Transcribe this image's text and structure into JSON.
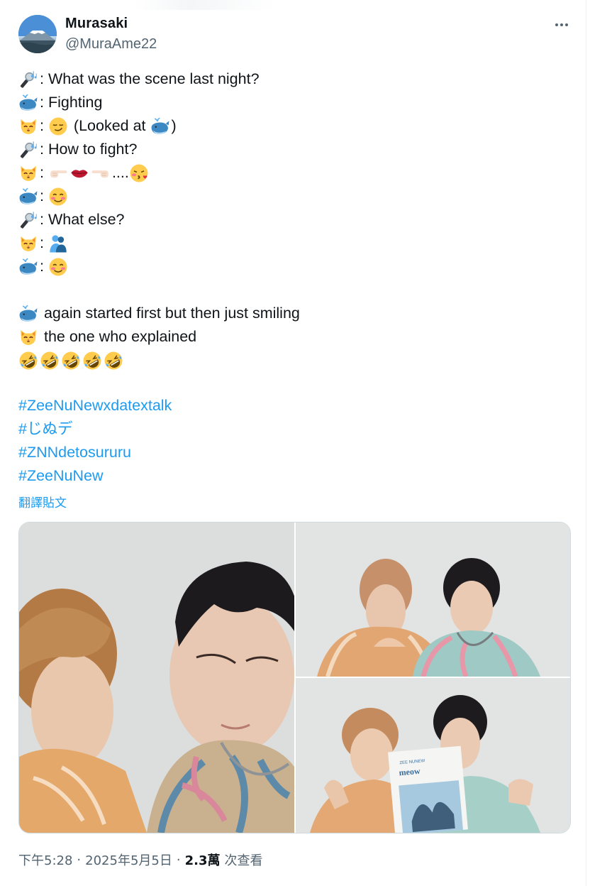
{
  "author": {
    "display_name": "Murasaki",
    "handle": "@MuraAme22",
    "avatar_icon": "avatar-mount-fuji"
  },
  "more_icon": "more-dots-icon",
  "tweet": {
    "lines": [
      {
        "icons": [
          "microphone-music-icon"
        ],
        "text": ": What was the scene last night?"
      },
      {
        "icons": [
          "whale-icon"
        ],
        "text": ": Fighting"
      },
      {
        "icons": [
          "cat-face-icon"
        ],
        "text": ": ",
        "icons2": [
          "smirk-face-icon"
        ],
        "text2": " (Looked at ",
        "icons3": [
          "whale-icon"
        ],
        "text3": ")"
      },
      {
        "icons": [
          "microphone-music-icon"
        ],
        "text": ": How to fight?"
      },
      {
        "icons": [
          "cat-face-icon"
        ],
        "text": ": ",
        "icons2": [
          "pointing-right-icon",
          "lips-icon",
          "pointing-left-icon"
        ],
        "text2": "....",
        "icons3": [
          "kissing-face-icon"
        ],
        "text3": ""
      },
      {
        "icons": [
          "whale-icon"
        ],
        "text": ": ",
        "icons2": [
          "smiling-blush-icon"
        ],
        "text2": ""
      },
      {
        "icons": [
          "microphone-music-icon"
        ],
        "text": ": What else?"
      },
      {
        "icons": [
          "cat-face-icon"
        ],
        "text": ": ",
        "icons2": [
          "hugging-people-icon"
        ],
        "text2": ""
      },
      {
        "icons": [
          "whale-icon"
        ],
        "text": ": ",
        "icons2": [
          "smiling-blush-icon"
        ],
        "text2": ""
      },
      {
        "icons": [],
        "text": ""
      },
      {
        "icons": [
          "whale-icon"
        ],
        "text": " again started first but then just smiling"
      },
      {
        "icons": [
          "cat-face-icon"
        ],
        "text": " the one who explained"
      },
      {
        "icons": [
          "rofl-icon",
          "rofl-icon",
          "rofl-icon",
          "rofl-icon",
          "rofl-icon"
        ],
        "text": ""
      }
    ],
    "hashtags": [
      "#ZeeNuNewxdatextalk",
      "#じぬデ",
      "#ZNNdetosururu",
      "#ZeeNuNew"
    ],
    "translate_label": "翻譯貼文"
  },
  "media": {
    "photos": [
      "photo-1",
      "photo-2",
      "photo-3"
    ],
    "photo3_card": {
      "line1": "ZEE NUNEW",
      "line2": "meow"
    }
  },
  "meta": {
    "time": "下午5:28",
    "separator": "·",
    "date": "2025年5月5日",
    "views_count": "2.3萬",
    "views_label": "次查看"
  },
  "colors": {
    "link": "#1d9bf0",
    "muted": "#536471",
    "text": "#0f1419"
  }
}
